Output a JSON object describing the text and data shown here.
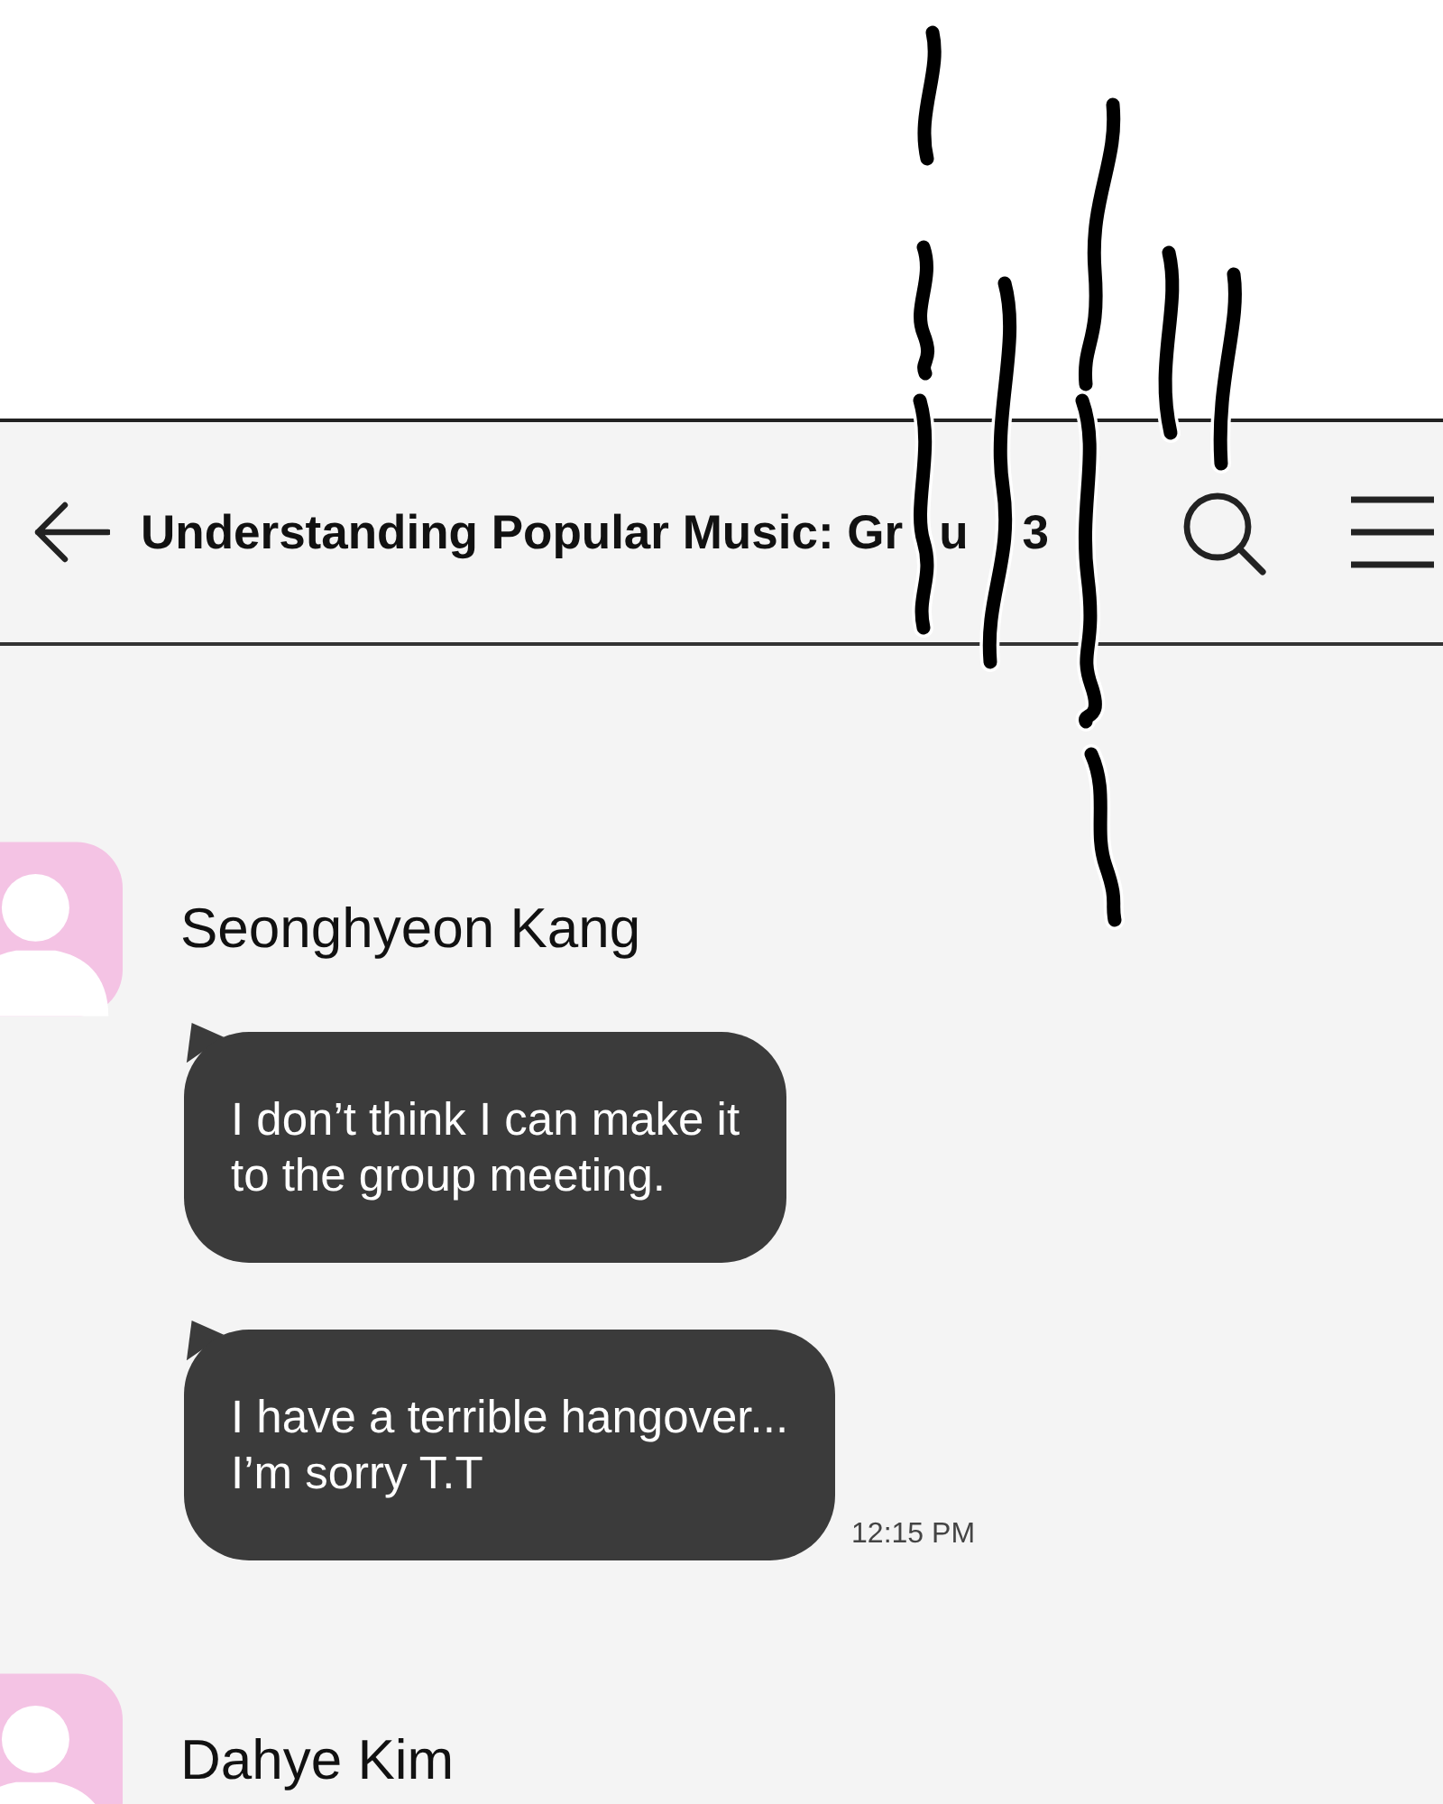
{
  "header": {
    "title_fragments": [
      "Understanding Popular Music: Gr",
      "u",
      "3"
    ]
  },
  "message_groups": [
    {
      "sender": "Seonghyeon Kang",
      "messages": [
        {
          "text": "I don’t think I can make it\nto the group meeting."
        },
        {
          "text": "I have a terrible hangover...\nI’m sorry T.T",
          "time": "12:15 PM"
        }
      ]
    },
    {
      "sender": "Dahye Kim"
    }
  ]
}
